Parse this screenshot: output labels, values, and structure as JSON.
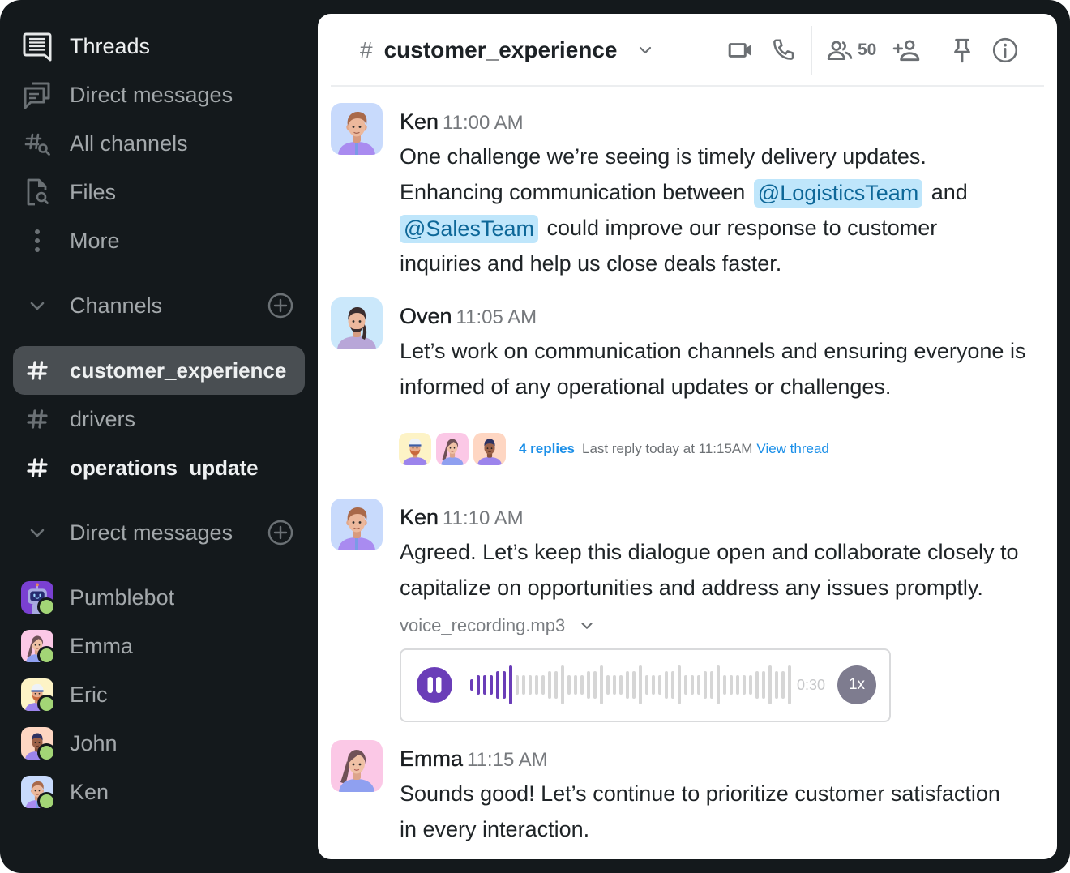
{
  "sidebar": {
    "nav": [
      {
        "label": "Threads",
        "icon": "threads-icon"
      },
      {
        "label": "Direct messages",
        "icon": "direct-messages-icon"
      },
      {
        "label": "All channels",
        "icon": "all-channels-search-icon"
      },
      {
        "label": "Files",
        "icon": "files-search-icon"
      },
      {
        "label": "More",
        "icon": "more-vertical-icon"
      }
    ],
    "channels_header": {
      "label": "Channels",
      "collapse_icon": "chevron-down-icon",
      "add_icon": "plus-circle-icon"
    },
    "channels": [
      {
        "name": "customer_experience",
        "state": "active"
      },
      {
        "name": "drivers",
        "state": "read"
      },
      {
        "name": "operations_update",
        "state": "unread"
      }
    ],
    "dm_header": {
      "label": "Direct messages",
      "collapse_icon": "chevron-down-icon",
      "add_icon": "plus-circle-icon"
    },
    "direct_messages": [
      {
        "name": "Pumblebot",
        "status": "online"
      },
      {
        "name": "Emma",
        "status": "online"
      },
      {
        "name": "Eric",
        "status": "online"
      },
      {
        "name": "John",
        "status": "online"
      },
      {
        "name": "Ken",
        "status": "online"
      }
    ]
  },
  "channel_header": {
    "hash_symbol": "#",
    "title": "customer_experience",
    "member_count": "50",
    "icons": [
      "chevron-down-icon",
      "video-call-icon",
      "phone-call-icon",
      "members-icon",
      "add-member-icon",
      "pin-icon",
      "info-icon"
    ]
  },
  "messages": [
    {
      "author": "Ken",
      "time": "11:00 AM",
      "lines": [
        [
          {
            "type": "text",
            "text": "One challenge we’re seeing is timely delivery updates."
          }
        ],
        [
          {
            "type": "text",
            "text": "Enhancing communication between "
          },
          {
            "type": "mention",
            "text": "@LogisticsTeam"
          },
          {
            "type": "text",
            "text": " and"
          }
        ],
        [
          {
            "type": "mention",
            "text": "@SalesTeam"
          },
          {
            "type": "text",
            "text": " could improve our response to customer"
          }
        ],
        [
          {
            "type": "text",
            "text": "inquiries and help us close deals faster."
          }
        ]
      ]
    },
    {
      "author": "Oven",
      "time": "11:05 AM",
      "lines": [
        [
          {
            "type": "text",
            "text": "Let’s work on communication channels and ensuring everyone is"
          }
        ],
        [
          {
            "type": "text",
            "text": "informed of any operational updates or challenges."
          }
        ]
      ],
      "thread": {
        "participants": [
          "Eric",
          "Emma",
          "John"
        ],
        "reply_count_label": "4 replies",
        "last_reply": "Last reply today at 11:15AM",
        "view_label": "View thread"
      }
    },
    {
      "author": "Ken",
      "time": "11:10 AM",
      "lines": [
        [
          {
            "type": "text",
            "text": "Agreed. Let’s keep this dialogue open and collaborate closely to"
          }
        ],
        [
          {
            "type": "text",
            "text": "capitalize on opportunities and address any issues promptly."
          }
        ]
      ],
      "attachment": {
        "filename": "voice_recording.mp3",
        "playback_state": "playing",
        "duration": "0:30",
        "speed": "1x",
        "progress": 0.14,
        "waveform_levels": [
          1,
          2,
          2,
          2,
          3,
          3,
          4,
          2,
          2,
          2,
          2,
          2,
          3,
          3,
          4,
          2,
          2,
          2,
          3,
          3,
          4,
          2,
          2,
          2,
          3,
          3,
          4,
          2,
          2,
          2,
          3,
          3,
          4,
          2,
          2,
          2,
          3,
          3,
          4,
          2,
          2,
          2,
          2,
          2,
          3,
          3,
          4,
          3,
          3,
          4
        ]
      }
    },
    {
      "author": "Emma",
      "time": "11:15 AM",
      "lines": [
        [
          {
            "type": "text",
            "text": "Sounds good! Let’s continue to prioritize customer satisfaction"
          }
        ],
        [
          {
            "type": "text",
            "text": "in every interaction."
          }
        ]
      ]
    }
  ],
  "colors": {
    "sidebar_bg": "#14191c",
    "active_item_bg": "#494e52",
    "accent_purple": "#6a3db8",
    "mention_bg": "#bfe6fb",
    "mention_text": "#0d6798",
    "link_blue": "#1b8fe8",
    "online_green": "#a3d576",
    "waveform_unplayed": "#d6d6d6"
  }
}
